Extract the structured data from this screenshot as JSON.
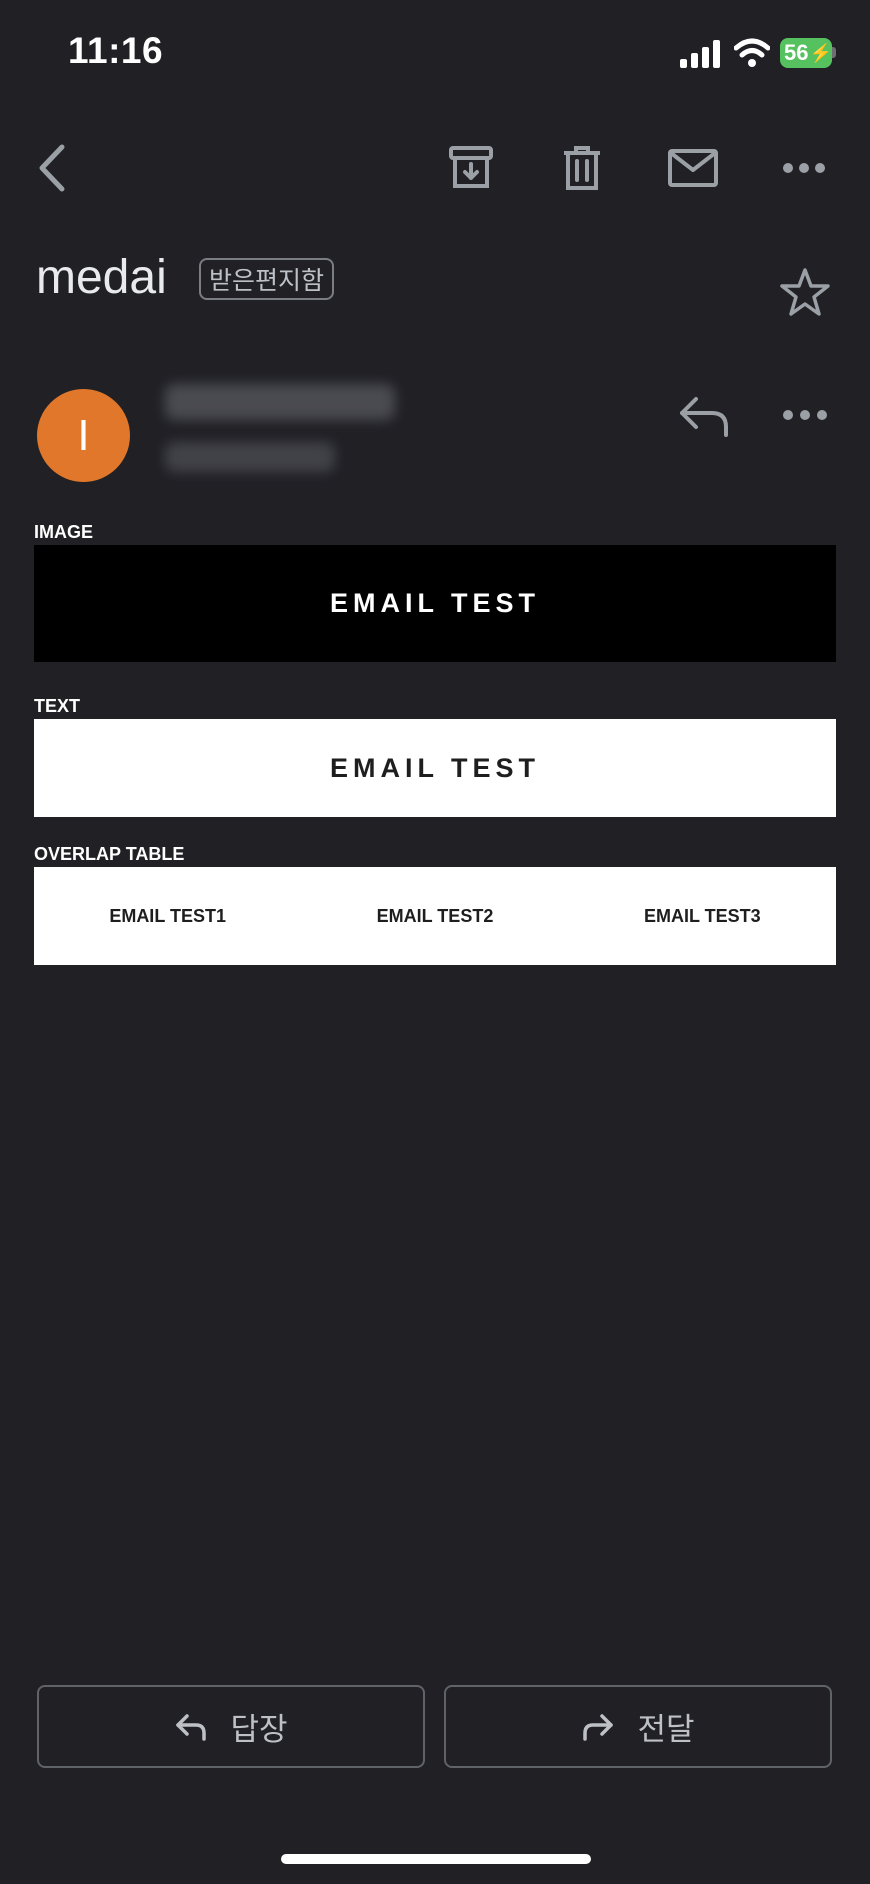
{
  "status_bar": {
    "time": "11:16",
    "battery": "56"
  },
  "toolbar": {
    "back_icon": "chevron-left-icon",
    "archive_icon": "archive-icon",
    "delete_icon": "trash-icon",
    "unread_icon": "mail-icon",
    "more_icon": "more-horizontal-icon"
  },
  "message": {
    "subject": "medai",
    "label": "받은편지함",
    "sender_initial": "I",
    "avatar_color": "#e1772b"
  },
  "email_body": {
    "image_label": "IMAGE",
    "image_text": "EMAIL TEST",
    "text_label": "TEXT",
    "text_content": "EMAIL TEST",
    "table_label": "OVERLAP TABLE",
    "table_cells": [
      "EMAIL TEST1",
      "EMAIL TEST2",
      "EMAIL TEST3"
    ]
  },
  "actions": {
    "reply": "답장",
    "forward": "전달"
  }
}
